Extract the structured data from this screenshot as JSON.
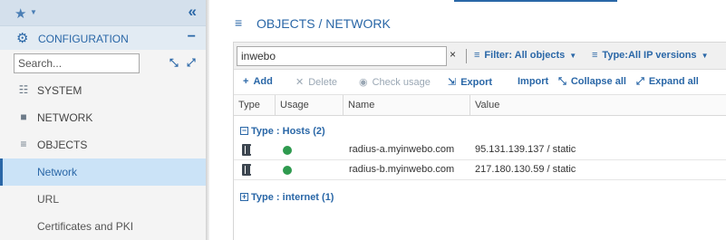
{
  "sidebar": {
    "favorites_icon": "star-icon",
    "collapse_icon": "double-chevron-left-icon",
    "section_title": "CONFIGURATION",
    "section_toggle": "−",
    "search_placeholder": "Search...",
    "items": [
      {
        "label": "SYSTEM",
        "icon": "sliders-icon"
      },
      {
        "label": "NETWORK",
        "icon": "network-icon"
      },
      {
        "label": "OBJECTS",
        "icon": "database-icon"
      },
      {
        "label": "Network",
        "active": true
      },
      {
        "label": "URL"
      },
      {
        "label": "Certificates and PKI"
      }
    ]
  },
  "header": {
    "title": "OBJECTS / NETWORK",
    "icon": "database-icon"
  },
  "filterbar": {
    "search_value": "inwebo",
    "clear": "×",
    "filter_label": "Filter: All objects",
    "type_label": "Type:All IP versions"
  },
  "toolbar": {
    "add": "Add",
    "delete": "Delete",
    "check_usage": "Check usage",
    "export": "Export",
    "import": "Import",
    "collapse_all": "Collapse all",
    "expand_all": "Expand all"
  },
  "table": {
    "columns": [
      "Type",
      "Usage",
      "Name",
      "Value"
    ],
    "groups": [
      {
        "label": "Type : Hosts (2)",
        "expanded": true,
        "rows": [
          {
            "name": "radius-a.myinwebo.com",
            "value": "95.131.139.137 / static"
          },
          {
            "name": "radius-b.myinwebo.com",
            "value": "217.180.130.59 / static"
          }
        ]
      },
      {
        "label": "Type : internet (1)",
        "expanded": false,
        "rows": []
      }
    ]
  },
  "colors": {
    "accent": "#2a67a7",
    "usage_dot": "#2f9a4f",
    "active_bg": "#cbe3f7"
  }
}
